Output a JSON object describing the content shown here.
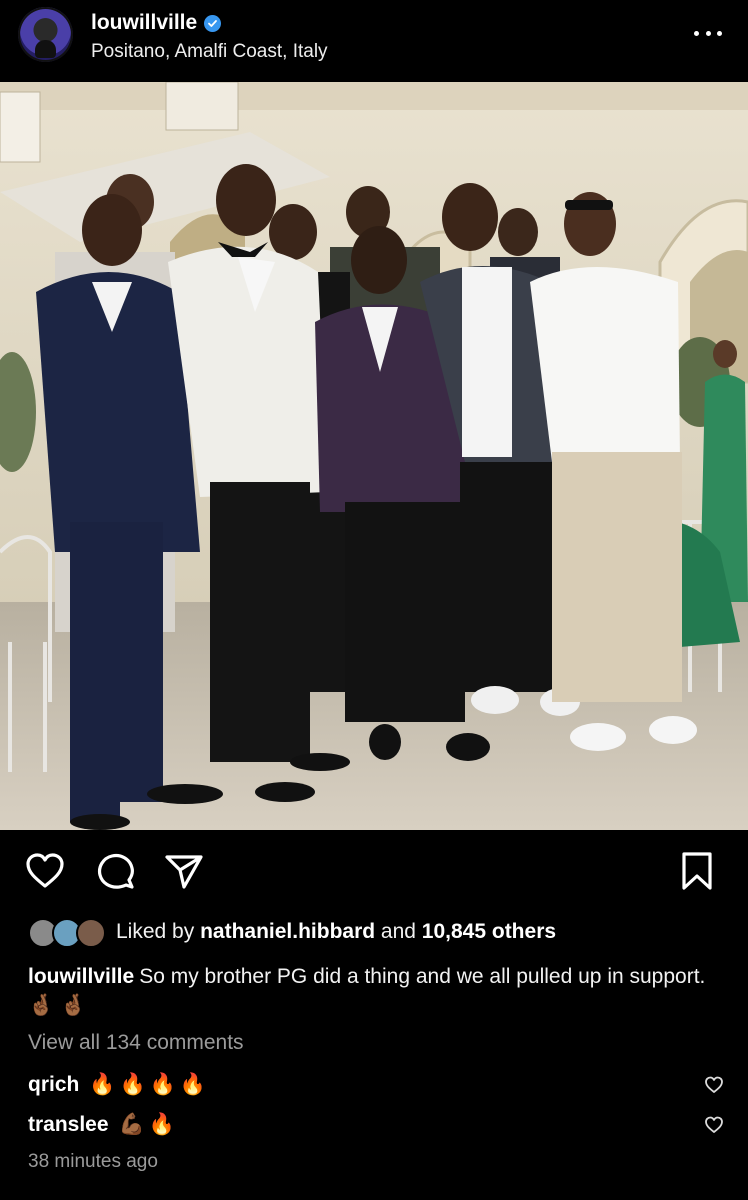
{
  "post": {
    "username": "louwillville",
    "location": "Positano, Amalfi Coast, Italy",
    "likes_prefix": "Liked by ",
    "liked_by": "nathaniel.hibbard",
    "likes_and": " and ",
    "likes_count": "10,845 others",
    "caption_user": "louwillville",
    "caption_text": "So my brother PG did a thing and we all pulled up in support. 🤞🏾 🤞🏾",
    "view_all_comments": "View all 134 comments",
    "timestamp": "38 minutes ago"
  },
  "comments": [
    {
      "user": "qrich",
      "text": "🔥🔥🔥🔥"
    },
    {
      "user": "translee",
      "text": "💪🏾🔥"
    }
  ],
  "icons": {
    "more": "more-options-icon",
    "like": "heart-icon",
    "comment": "comment-icon",
    "share": "share-icon",
    "save": "bookmark-icon",
    "verified": "verified-badge-icon"
  },
  "colors": {
    "background": "#000000",
    "text": "#f5f5f5",
    "secondary_text": "#9b9b9b",
    "verified": "#3897f0"
  }
}
